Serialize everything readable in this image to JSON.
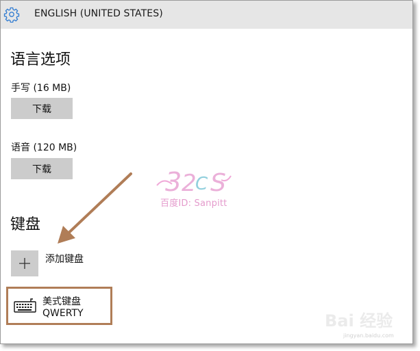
{
  "window": {
    "title": "ENGLISH (UNITED STATES)",
    "title_icon": "gear-icon"
  },
  "language_options": {
    "heading": "语言选项",
    "handwriting": {
      "label": "手写 (16 MB)",
      "button": "下载"
    },
    "speech": {
      "label": "语音 (120 MB)",
      "button": "下载"
    }
  },
  "keyboards": {
    "heading": "键盘",
    "add_label": "添加键盘",
    "add_icon": "plus-icon",
    "items": [
      {
        "name": "美式键盘",
        "layout": "QWERTY",
        "icon": "keyboard-icon"
      }
    ]
  },
  "watermark": {
    "text": "百度ID: Sanpitt",
    "logo": "32cs-logo"
  },
  "site_watermark": {
    "brand": "Bai 经验",
    "url": "jingyan.baidu.com"
  },
  "colors": {
    "titlebar_bg": "#e6e6e6",
    "button_bg": "#cccccc",
    "highlight_border": "#b07d57",
    "accent": "#2f7bd1"
  }
}
